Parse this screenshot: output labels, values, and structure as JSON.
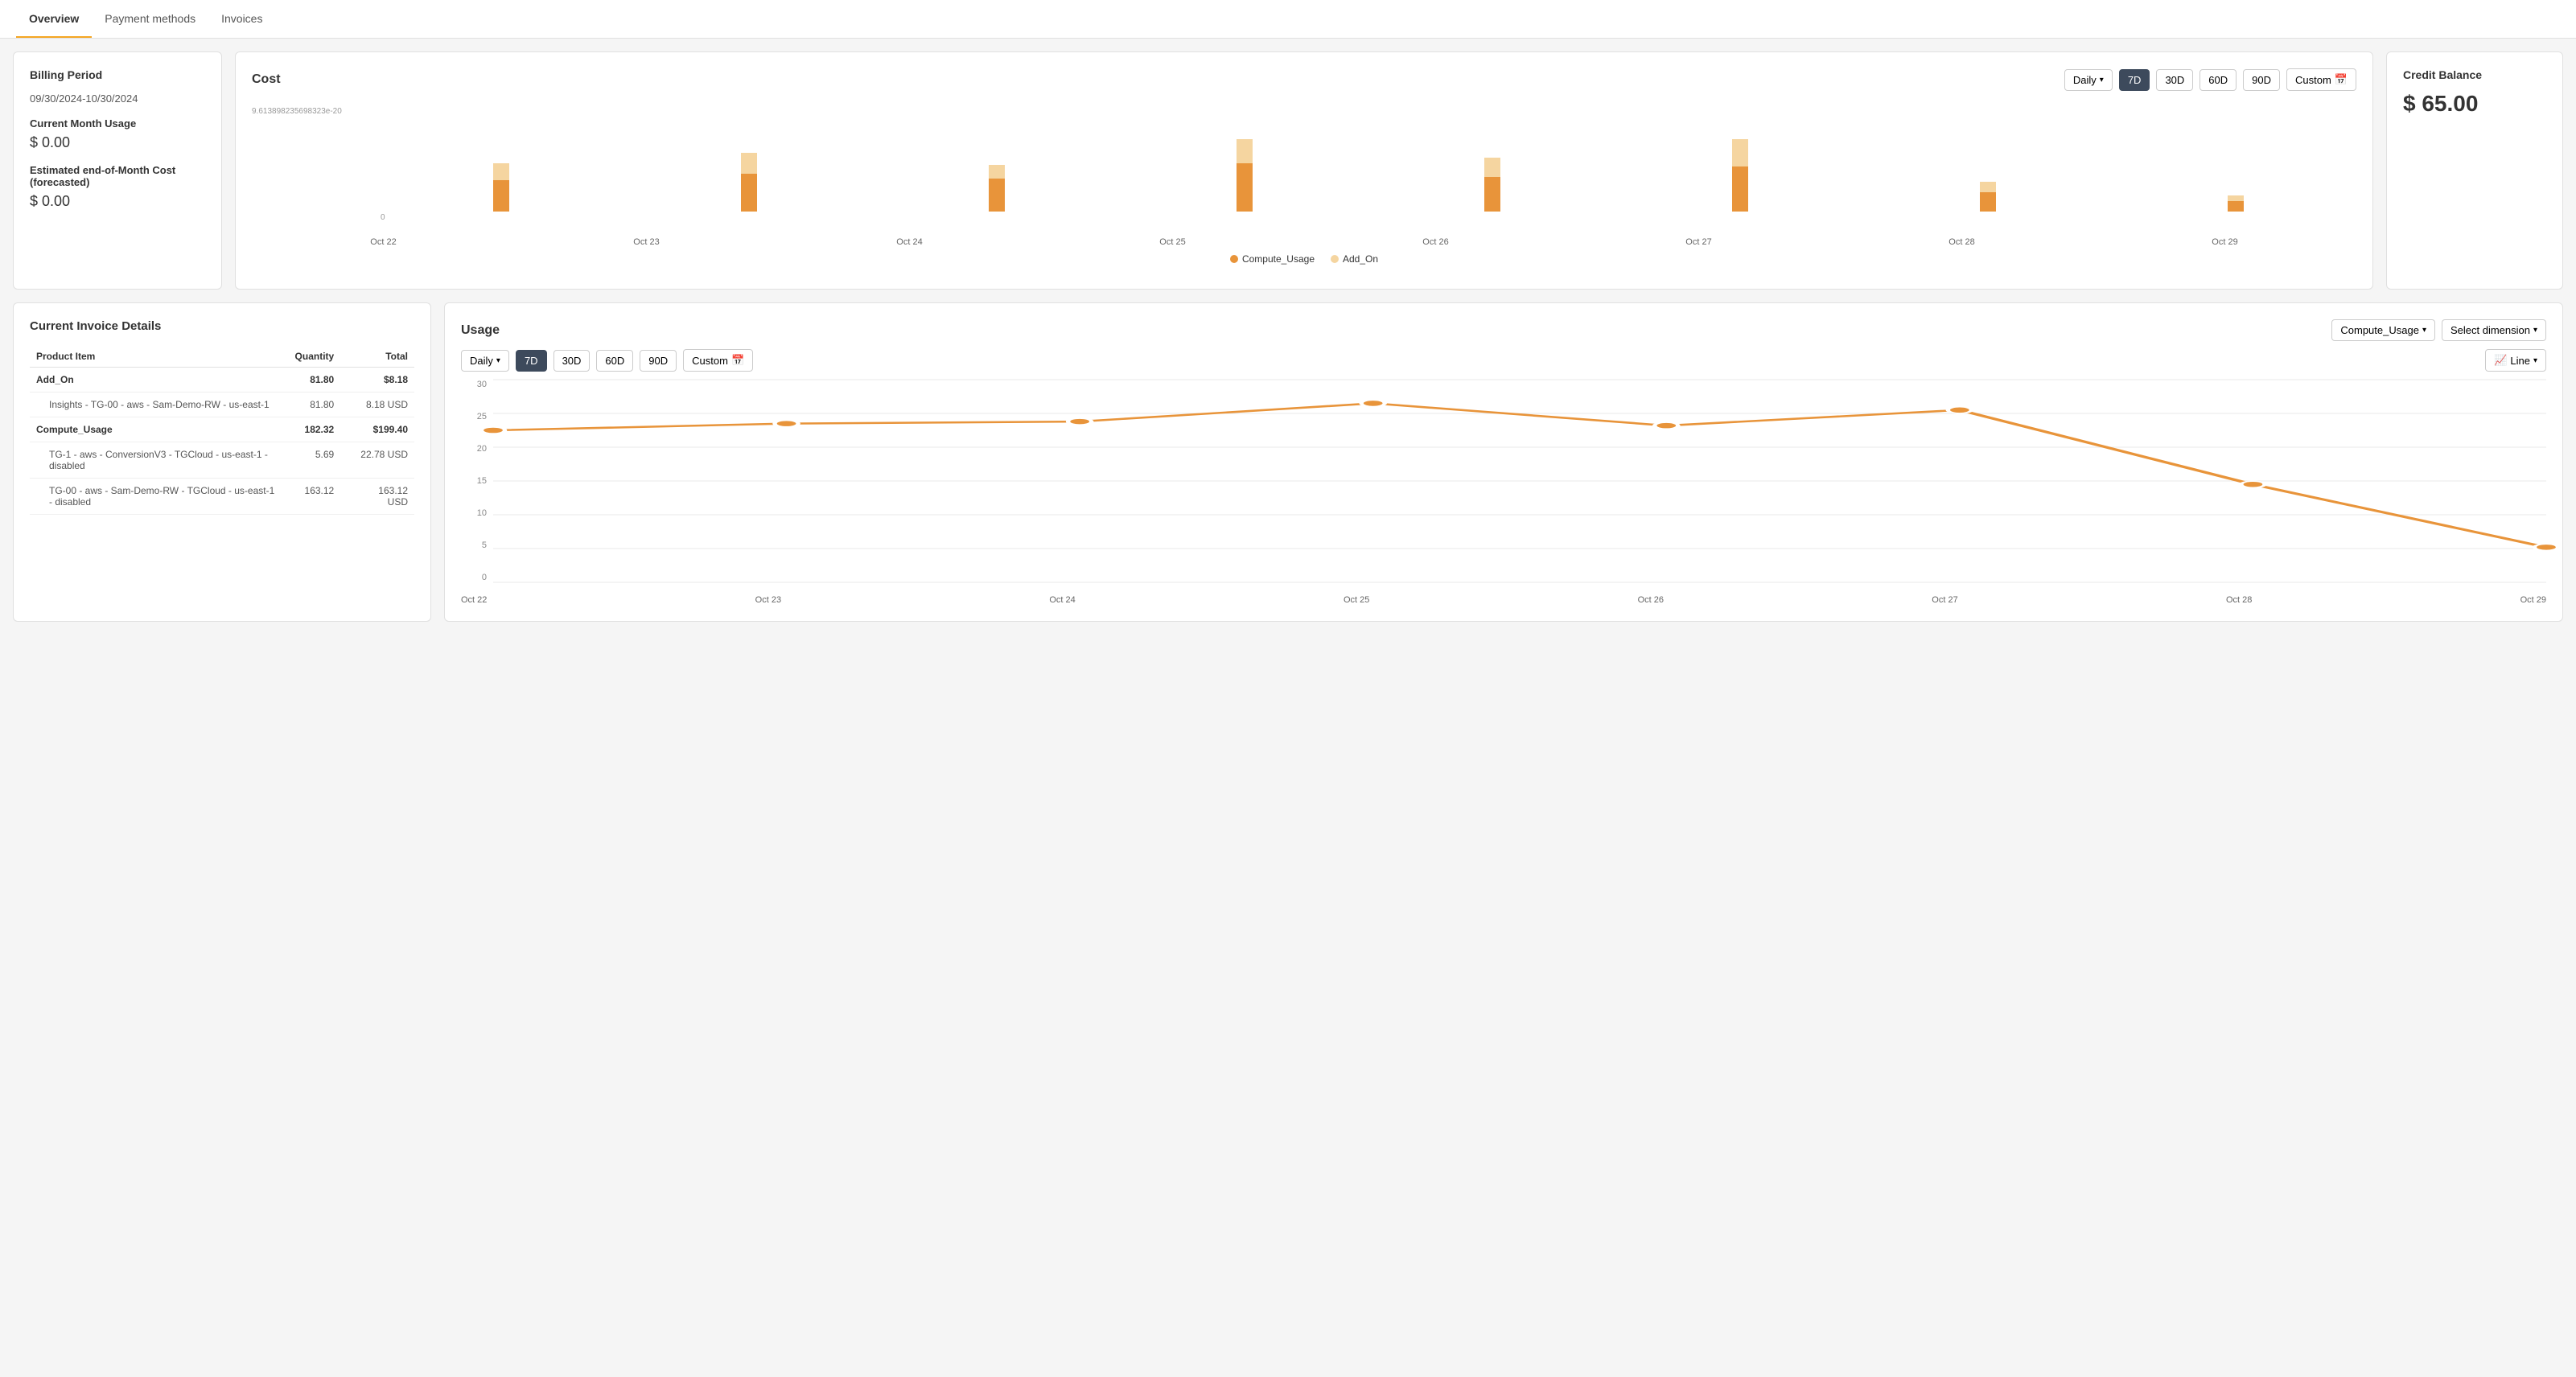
{
  "nav": {
    "tabs": [
      {
        "label": "Overview",
        "active": true
      },
      {
        "label": "Payment methods",
        "active": false
      },
      {
        "label": "Invoices",
        "active": false
      }
    ]
  },
  "billing": {
    "title": "Billing Period",
    "date_range": "09/30/2024-10/30/2024",
    "current_month_label": "Current Month Usage",
    "current_month_value": "$ 0.00",
    "forecasted_label": "Estimated end-of-Month Cost (forecasted)",
    "forecasted_value": "$ 0.00"
  },
  "cost": {
    "title": "Cost",
    "interval_label": "Daily",
    "period_buttons": [
      "7D",
      "30D",
      "60D",
      "90D"
    ],
    "custom_label": "Custom",
    "active_period": "7D",
    "y_axis_label": "9.613898235698323e-20",
    "zero_label": "0",
    "bars": [
      {
        "label": "Oct 22",
        "compute": 45,
        "addon": 25
      },
      {
        "label": "Oct 23",
        "compute": 55,
        "addon": 30
      },
      {
        "label": "Oct 24",
        "compute": 48,
        "addon": 20
      },
      {
        "label": "Oct 25",
        "compute": 70,
        "addon": 35
      },
      {
        "label": "Oct 26",
        "compute": 50,
        "addon": 28
      },
      {
        "label": "Oct 27",
        "compute": 65,
        "addon": 40
      },
      {
        "label": "Oct 28",
        "compute": 28,
        "addon": 15
      },
      {
        "label": "Oct 29",
        "compute": 15,
        "addon": 8
      }
    ],
    "legend": [
      {
        "label": "Compute_Usage",
        "color": "#e8943a"
      },
      {
        "label": "Add_On",
        "color": "#f5d5a0"
      }
    ]
  },
  "credit": {
    "title": "Credit Balance",
    "amount": "$ 65.00"
  },
  "invoice": {
    "title": "Current Invoice Details",
    "columns": [
      "Product Item",
      "Quantity",
      "Total"
    ],
    "rows": [
      {
        "type": "parent",
        "product": "Add_On",
        "quantity": "81.80",
        "total": "$8.18"
      },
      {
        "type": "sub",
        "product": "Insights - TG-00 - aws - Sam-Demo-RW - us-east-1",
        "quantity": "81.80",
        "total": "8.18 USD"
      },
      {
        "type": "parent",
        "product": "Compute_Usage",
        "quantity": "182.32",
        "total": "$199.40"
      },
      {
        "type": "sub",
        "product": "TG-1 - aws - ConversionV3 - TGCloud - us-east-1 - disabled",
        "quantity": "5.69",
        "total": "22.78 USD"
      },
      {
        "type": "sub",
        "product": "TG-00 - aws - Sam-Demo-RW - TGCloud - us-east-1 - disabled",
        "quantity": "163.12",
        "total": "163.12 USD"
      }
    ]
  },
  "usage": {
    "title": "Usage",
    "metric_label": "Compute_Usage",
    "dimension_label": "Select dimension",
    "interval_label": "Daily",
    "period_buttons": [
      "7D",
      "30D",
      "60D",
      "90D"
    ],
    "custom_label": "Custom",
    "active_period": "7D",
    "chart_type_label": "Line",
    "x_labels": [
      "Oct 22",
      "Oct 23",
      "Oct 24",
      "Oct 25",
      "Oct 26",
      "Oct 27",
      "Oct 28",
      "Oct 29"
    ],
    "y_labels": [
      "30",
      "25",
      "20",
      "15",
      "10",
      "5",
      "0"
    ],
    "line_points": [
      {
        "x": 0,
        "y": 22.5
      },
      {
        "x": 1,
        "y": 23.5
      },
      {
        "x": 2,
        "y": 23.8
      },
      {
        "x": 3,
        "y": 26.5
      },
      {
        "x": 4,
        "y": 23.2
      },
      {
        "x": 5,
        "y": 25.5
      },
      {
        "x": 6,
        "y": 14.5
      },
      {
        "x": 7,
        "y": 5.2
      }
    ]
  }
}
